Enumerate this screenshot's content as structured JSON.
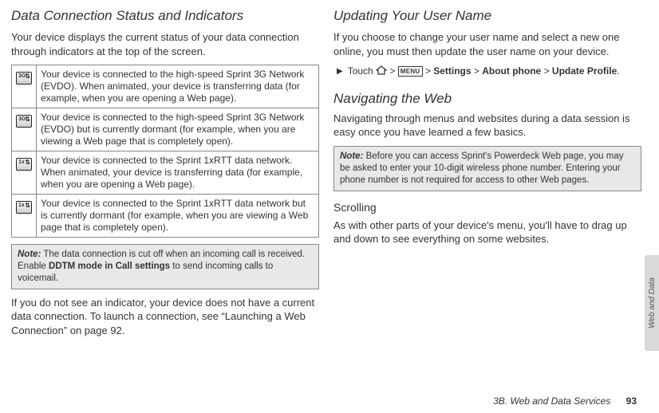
{
  "left": {
    "title": "Data Connection Status and Indicators",
    "intro": "Your device displays the current status of your data connection through indicators at the top of the screen.",
    "rows": [
      {
        "icon_label": "3G",
        "icon_name": "icon-3g-active",
        "desc": "Your device is connected to the high-speed Sprint 3G Network (EVDO). When animated, your device is transferring data (for example, when you are opening a Web page)."
      },
      {
        "icon_label": "3G",
        "icon_name": "icon-3g-dormant",
        "desc": "Your device is connected to the high-speed Sprint 3G Network (EVDO) but is currently dormant (for example, when you are viewing a Web page that is completely open)."
      },
      {
        "icon_label": "1x",
        "icon_name": "icon-1x-active",
        "desc": "Your device is connected to the Sprint 1xRTT data network. When animated, your device is transferring data (for example, when you are opening a Web page)."
      },
      {
        "icon_label": "1x",
        "icon_name": "icon-1x-dormant",
        "desc": "Your device is connected to the Sprint 1xRTT data network but is currently dormant (for example, when you are viewing a Web page that is completely open)."
      }
    ],
    "note_label": "Note:",
    "note_before": "The data connection is cut off when an incoming call is received.  Enable ",
    "note_bold": "DDTM mode in Call settings",
    "note_after": " to send incoming calls to voicemail.",
    "after": "If you do not see an indicator, your device does not have a current data connection. To launch a connection, see “Launching a Web Connection” on page 92."
  },
  "right": {
    "title1": "Updating Your User Name",
    "p1": "If you choose to change your user name and select a new one online, you must then update the user name on your device.",
    "step_touch": "Touch ",
    "step_sep": " > ",
    "menu_label": "MENU",
    "step_settings": "Settings",
    "step_about": "About phone",
    "step_update": "Update Profile",
    "title2": "Navigating the Web",
    "p2": "Navigating through menus and websites during a data session is easy once you have learned a few basics.",
    "note_label": "Note:",
    "note_text": "Before you can access Sprint's Powerdeck Web page, you may be asked to enter your 10-digit wireless phone number. Entering your phone number is not required for access to other Web pages.",
    "subhead": "Scrolling",
    "p3": "As with other parts of your device's menu, you'll have to drag up and down to see everything on some websites."
  },
  "footer": {
    "section": "3B. Web and Data Services",
    "page": "93"
  },
  "sidetab": "Web and Data"
}
